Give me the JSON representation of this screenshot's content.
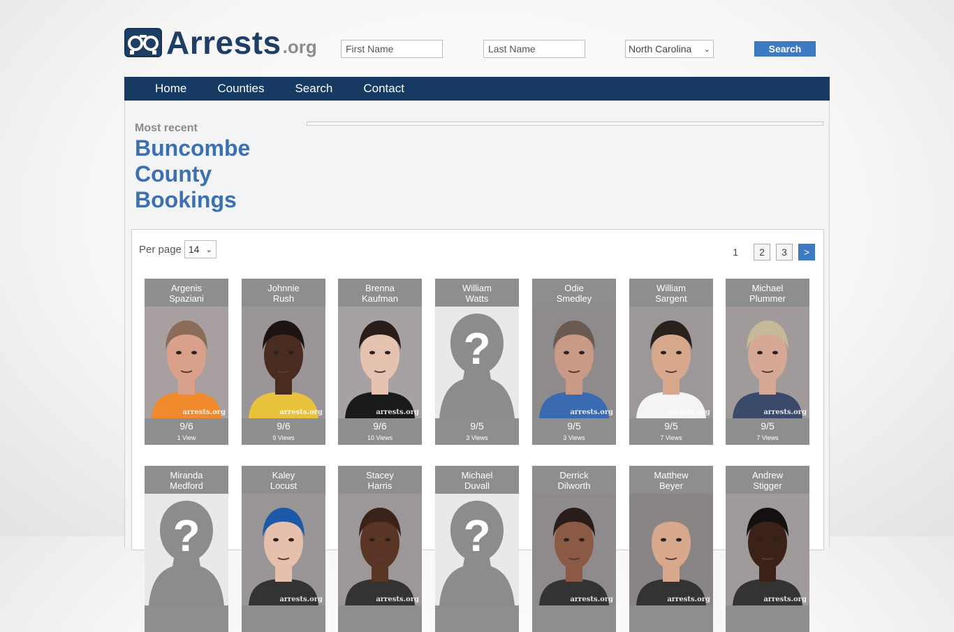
{
  "header": {
    "logo_text": "Arrests",
    "logo_suffix": ".org",
    "first_name_placeholder": "First Name",
    "last_name_placeholder": "Last Name",
    "state_selected": "North Carolina",
    "search_label": "Search"
  },
  "nav": {
    "items": [
      "Home",
      "Counties",
      "Search",
      "Contact"
    ]
  },
  "page": {
    "most_recent": "Most recent",
    "title_line1": "Buncombe",
    "title_line2": "County",
    "title_line3": "Bookings"
  },
  "listing": {
    "per_page_label": "Per page",
    "per_page_value": "14",
    "current_page": "1",
    "pages": [
      "2",
      "3"
    ],
    "next_label": ">",
    "watermark": "arrests.org",
    "cards": [
      {
        "first": "Argenis",
        "last": "Spaziani",
        "date": "9/6",
        "views": "1 View",
        "photo": "photo",
        "skin": "#d9a08a",
        "hair": "#8a6c58",
        "shirt": "#f08a2c",
        "bg": "#a89fa0"
      },
      {
        "first": "Johnnie",
        "last": "Rush",
        "date": "9/6",
        "views": "9 Views",
        "photo": "photo",
        "skin": "#4a2b20",
        "hair": "#1c1412",
        "shirt": "#e8c23a",
        "bg": "#9a9596"
      },
      {
        "first": "Brenna",
        "last": "Kaufman",
        "date": "9/6",
        "views": "10 Views",
        "photo": "photo",
        "skin": "#e6c2b0",
        "hair": "#2a1c18",
        "shirt": "#1a1a1a",
        "bg": "#a6a2a3"
      },
      {
        "first": "William",
        "last": "Watts",
        "date": "9/5",
        "views": "3 Views",
        "photo": "placeholder"
      },
      {
        "first": "Odie",
        "last": "Smedley",
        "date": "9/5",
        "views": "3 Views",
        "photo": "photo",
        "skin": "#c99a86",
        "hair": "#6a5a52",
        "shirt": "#3a6ab0",
        "bg": "#8f8a8b"
      },
      {
        "first": "William",
        "last": "Sargent",
        "date": "9/5",
        "views": "7 Views",
        "photo": "photo",
        "skin": "#d8a88c",
        "hair": "#2a201c",
        "shirt": "#f4f4f4",
        "bg": "#9c9798"
      },
      {
        "first": "Michael",
        "last": "Plummer",
        "date": "9/5",
        "views": "7 Views",
        "photo": "photo",
        "skin": "#d6a896",
        "hair": "#c8b89a",
        "shirt": "#3a4a6a",
        "bg": "#a09a9a"
      },
      {
        "first": "Miranda",
        "last": "Medford",
        "date": "",
        "views": "",
        "photo": "placeholder"
      },
      {
        "first": "Kaley",
        "last": "Locust",
        "date": "",
        "views": "",
        "photo": "photo",
        "skin": "#e6c0ac",
        "hair": "#1c5aa8",
        "shirt": "#333",
        "bg": "#9a9596"
      },
      {
        "first": "Stacey",
        "last": "Harris",
        "date": "",
        "views": "",
        "photo": "photo",
        "skin": "#5a3526",
        "hair": "#3a2218",
        "shirt": "#333",
        "bg": "#9c9798"
      },
      {
        "first": "Michael",
        "last": "Duvall",
        "date": "",
        "views": "",
        "photo": "placeholder"
      },
      {
        "first": "Derrick",
        "last": "Dilworth",
        "date": "",
        "views": "",
        "photo": "photo",
        "skin": "#8a5a44",
        "hair": "#2a1c18",
        "shirt": "#333",
        "bg": "#8f8a8b"
      },
      {
        "first": "Matthew",
        "last": "Beyer",
        "date": "",
        "views": "",
        "photo": "photo",
        "skin": "#d8a88c",
        "hair": "#8a8484",
        "shirt": "#333",
        "bg": "#8a8585"
      },
      {
        "first": "Andrew",
        "last": "Stigger",
        "date": "",
        "views": "",
        "photo": "photo",
        "skin": "#3a2218",
        "hair": "#141010",
        "shirt": "#333",
        "bg": "#a09a9a"
      }
    ]
  }
}
